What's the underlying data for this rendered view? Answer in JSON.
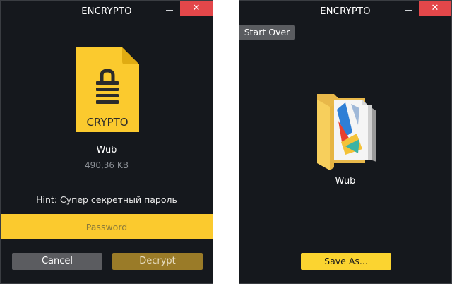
{
  "left_window": {
    "title": "ENCRYPTO",
    "close_glyph": "✕",
    "file_icon": {
      "name": "locked-file-icon",
      "label": "CRYPTO",
      "color": "#fbca2e"
    },
    "file_name": "Wub",
    "file_size": "490,36 KB",
    "hint": "Hint: Супер секретный пароль",
    "password_placeholder": "Password",
    "cancel_label": "Cancel",
    "decrypt_label": "Decrypt"
  },
  "right_window": {
    "title": "ENCRYPTO",
    "close_glyph": "✕",
    "start_over_label": "Start Over",
    "folder_icon": {
      "name": "folder-icon"
    },
    "folder_name": "Wub",
    "save_label": "Save As..."
  },
  "colors": {
    "window_bg": "#15181d",
    "accent_yellow": "#fbca2e",
    "close_red": "#e3474a",
    "button_gray": "#5b5c60",
    "decrypt_dim": "#9a7b28"
  }
}
